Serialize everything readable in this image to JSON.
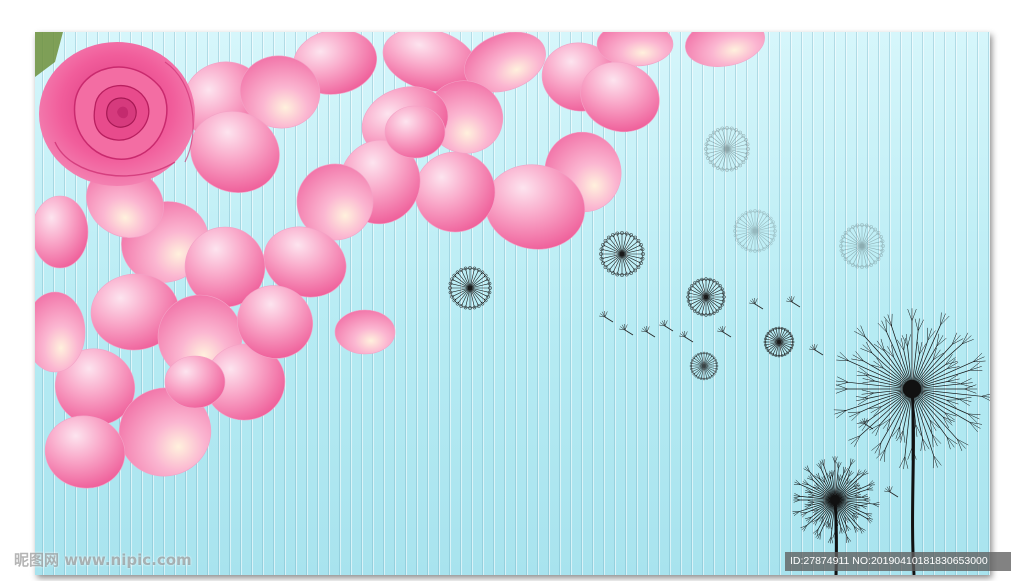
{
  "image": {
    "description_tokens": {
      "rose_color": "#f05a97",
      "petal_color": "#f78cb8",
      "petal_light": "#fde4ef",
      "background_top": "#d6f6fb",
      "background_bottom": "#a8e3ee",
      "dandelion_color": "#1a1a1a"
    }
  },
  "watermark": {
    "site_text": "昵图网 www.nipic.com",
    "id_text": "ID:27874911 NO:20190410181830653000"
  }
}
